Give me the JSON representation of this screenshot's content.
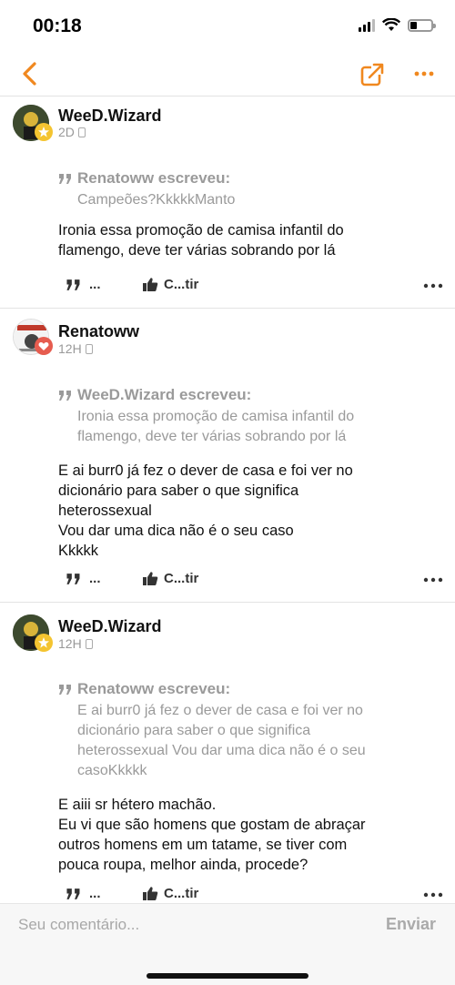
{
  "status_bar": {
    "time": "00:18"
  },
  "colors": {
    "accent": "#f0881f",
    "meta_gray": "#999999",
    "quote_gray": "#9a9a9a"
  },
  "posts": [
    {
      "author": "WeeD.Wizard",
      "time": "2D",
      "quote_header": "Renatoww escreveu:",
      "quote_body": "Campeões?KkkkkManto",
      "content": "Ironia essa promoção de camisa infantil do\nflamengo, deve ter várias sobrando por lá",
      "quote_action": "...",
      "like_action": "C...tir"
    },
    {
      "author": "Renatoww",
      "time": "12H",
      "quote_header": "WeeD.Wizard escreveu:",
      "quote_body": "Ironia essa promoção de camisa infantil do\nflamengo, deve ter várias sobrando por lá",
      "content": "E ai burr0 já fez o dever de casa e foi ver no\ndicionário para saber o que significa\nheterossexual\nVou dar uma dica não é o seu caso\nKkkkk",
      "quote_action": "...",
      "like_action": "C...tir"
    },
    {
      "author": "WeeD.Wizard",
      "time": "12H",
      "quote_header": "Renatoww escreveu:",
      "quote_body": "E ai burr0 já fez o dever de casa e foi ver no\ndicionário para saber o que significa\nheterossexual Vou dar uma dica não é o seu\ncasoKkkkk",
      "content": "E aiii sr hétero machão.\nEu vi que são homens que gostam de abraçar\noutros homens em um tatame, se tiver com\npouca roupa, melhor ainda, procede?",
      "quote_action": "...",
      "like_action": "C...tir"
    }
  ],
  "comment_bar": {
    "placeholder": "Seu comentário...",
    "send_label": "Enviar"
  },
  "icons": {
    "back": "chevron-left-icon",
    "share": "external-share-icon",
    "more": "more-dots-icon",
    "quote": "quote-icon",
    "like": "thumbs-up-icon"
  }
}
